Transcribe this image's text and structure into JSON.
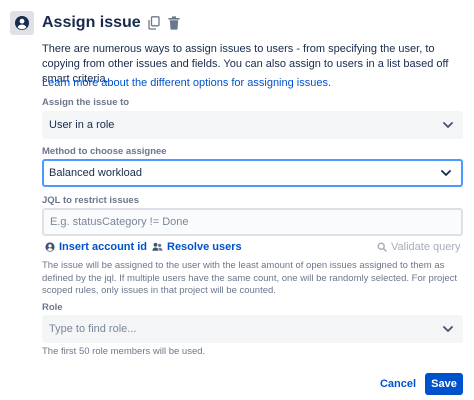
{
  "header": {
    "title": "Assign issue",
    "icon": "user-circle-icon",
    "copy_icon": "copy-icon",
    "delete_icon": "trash-icon"
  },
  "description": "There are numerous ways to assign issues to users - from specifying the user, to copying from other issues and fields. You can also assign to users in a list based off smart criteria.",
  "learn_more_link": "Learn more about the different options for assigning issues.",
  "assign_field": {
    "label": "Assign the issue to",
    "value": "User in a role"
  },
  "method_field": {
    "label": "Method to choose assignee",
    "value": "Balanced workload"
  },
  "jql_field": {
    "label": "JQL to restrict issues",
    "value": "",
    "placeholder": "E.g. statusCategory != Done"
  },
  "jql_actions": {
    "insert_account_id": "Insert account id",
    "resolve_users": "Resolve users",
    "validate_query": "Validate query"
  },
  "method_help": "The issue will be assigned to the user with the least amount of open issues assigned to them as defined by the jql. If multiple users have the same count, one will be randomly selected. For project scoped rules, only issues in that project will be counted.",
  "role_field": {
    "label": "Role",
    "placeholder": "Type to find role...",
    "help": "The first 50 role members will be used."
  },
  "footer": {
    "cancel_label": "Cancel",
    "save_label": "Save"
  },
  "colors": {
    "primary": "#0052cc",
    "focus_border": "#4c9aff",
    "subtle_text": "#6b778c"
  }
}
